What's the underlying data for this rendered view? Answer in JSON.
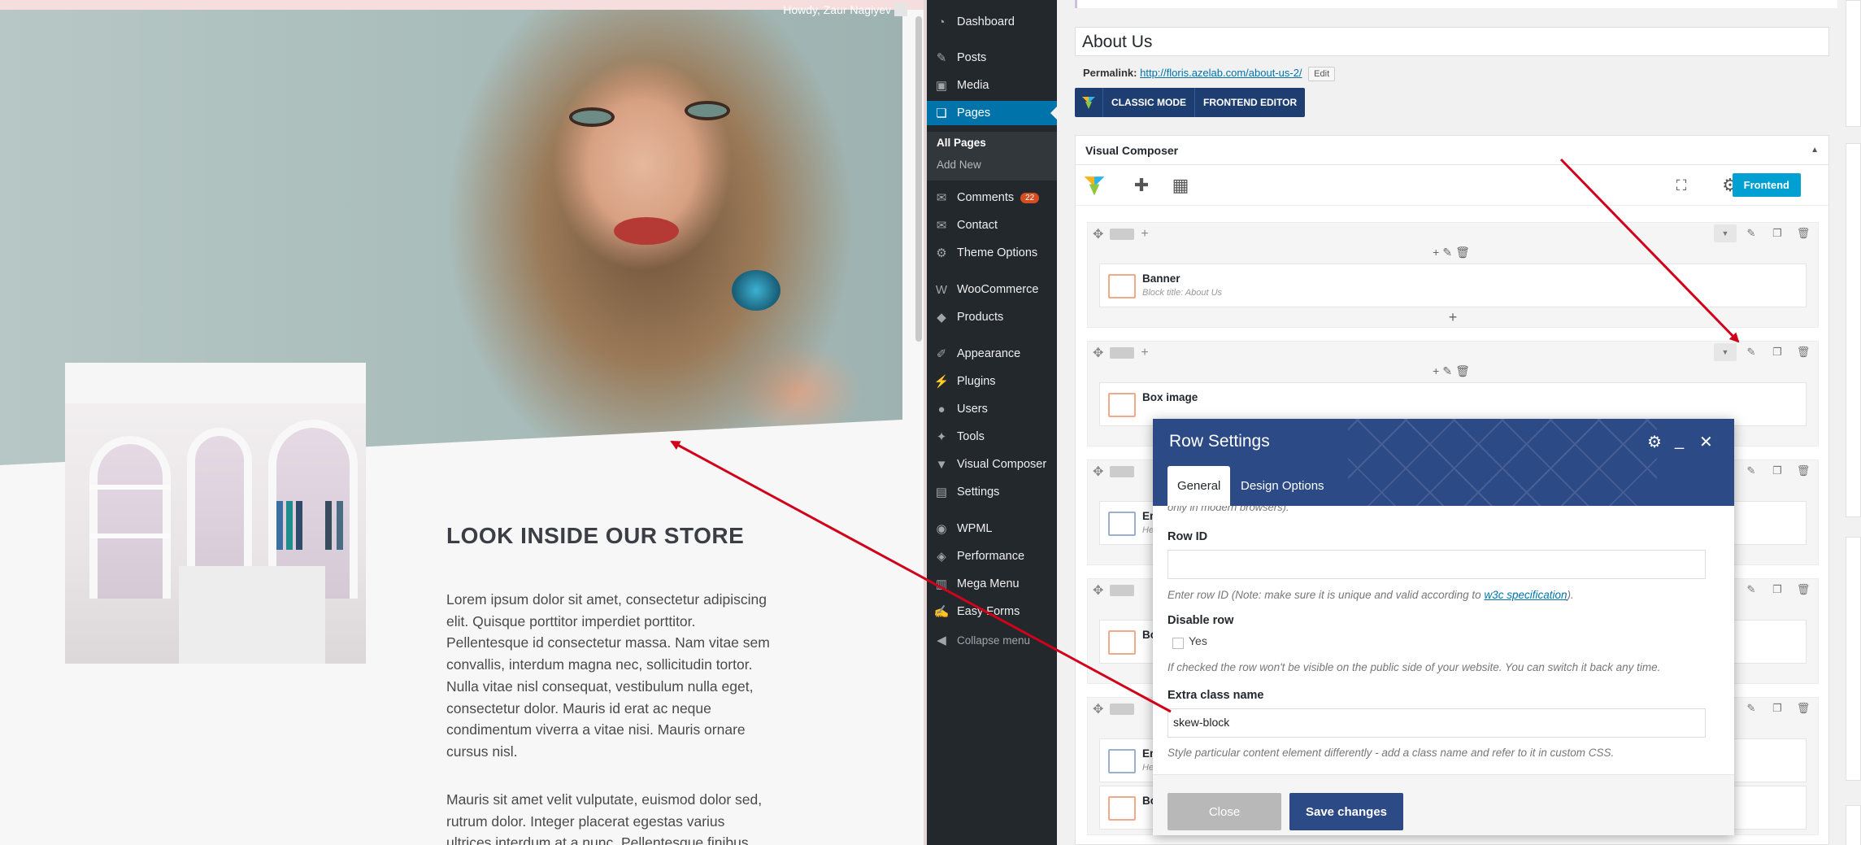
{
  "preview": {
    "howdy": "Howdy, Zaur Nagiyev",
    "section_title": "LOOK INSIDE OUR STORE",
    "paragraph1_lines": [
      "Lorem ipsum dolor sit amet, consectetur adipiscing",
      "elit. Quisque porttitor imperdiet porttitor.",
      "Pellentesque id consectetur massa. Nam vitae sem",
      "convallis, interdum magna nec, sollicitudin tortor.",
      "Nulla vitae nisl consequat, vestibulum nulla eget,",
      "consectetur dolor. Mauris id erat ac neque",
      "condimentum viverra a vitae nisi. Mauris ornare",
      "cursus nisl."
    ],
    "paragraph2_lines": [
      "Mauris sit amet velit vulputate, euismod dolor sed,",
      "rutrum dolor. Integer placerat egestas varius",
      "ultrices interdum at a nunc. Pellentesque finibus"
    ]
  },
  "admin_menu": {
    "items": [
      {
        "label": "Dashboard",
        "icon": "dashboard-icon"
      },
      {
        "label": "Posts",
        "icon": "pin-icon"
      },
      {
        "label": "Media",
        "icon": "media-icon"
      },
      {
        "label": "Pages",
        "icon": "pages-icon",
        "active": true
      },
      {
        "label": "Comments",
        "icon": "comment-icon",
        "badge": "22"
      },
      {
        "label": "Contact",
        "icon": "mail-icon"
      },
      {
        "label": "Theme Options",
        "icon": "gear-icon"
      },
      {
        "label": "WooCommerce",
        "icon": "woo-icon"
      },
      {
        "label": "Products",
        "icon": "box-icon"
      },
      {
        "label": "Appearance",
        "icon": "brush-icon"
      },
      {
        "label": "Plugins",
        "icon": "plug-icon"
      },
      {
        "label": "Users",
        "icon": "user-icon"
      },
      {
        "label": "Tools",
        "icon": "wrench-icon"
      },
      {
        "label": "Visual Composer",
        "icon": "vc-icon"
      },
      {
        "label": "Settings",
        "icon": "settings-icon"
      },
      {
        "label": "WPML",
        "icon": "chat-icon"
      },
      {
        "label": "Performance",
        "icon": "performance-icon"
      },
      {
        "label": "Mega Menu",
        "icon": "megamenu-icon"
      },
      {
        "label": "Easy Forms",
        "icon": "forms-icon"
      }
    ],
    "submenu": [
      "All Pages",
      "Add New"
    ],
    "collapse": "Collapse menu"
  },
  "editor": {
    "title": "About Us",
    "permalink_label": "Permalink:",
    "permalink_url": "http://floris.azelab.com/about-us-2/",
    "edit_label": "Edit",
    "classic_mode": "CLASSIC MODE",
    "frontend_editor": "FRONTEND EDITOR",
    "vc_title": "Visual Composer",
    "frontend_btn": "Frontend",
    "banner_title": "Banner",
    "banner_sub": "Block title: About Us",
    "box_image": "Box image",
    "el_partial_1": "Em",
    "el_partial_1_sub": "He",
    "el_partial_2": "Bo",
    "el_partial_3": "Em",
    "el_partial_3_sub": "He",
    "el_partial_4": "Bo"
  },
  "modal": {
    "title": "Row Settings",
    "tab_general": "General",
    "tab_design": "Design Options",
    "cut_text": "only in modern browsers).",
    "row_id_label": "Row ID",
    "row_id_value": "",
    "row_id_help": "Enter row ID (Note: make sure it is unique and valid according to ",
    "row_id_link": "w3c specification",
    "row_id_help_end": ").",
    "disable_label": "Disable row",
    "disable_yes": "Yes",
    "disable_help": "If checked the row won't be visible on the public side of your website. You can switch it back any time.",
    "extra_label": "Extra class name",
    "extra_value": "skew-block",
    "extra_help": "Style particular content element differently - add a class name and refer to it in custom CSS.",
    "close": "Close",
    "save": "Save changes"
  },
  "colors": {
    "wp_admin_dark": "#23282d",
    "wp_blue": "#0073aa",
    "vc_blue": "#2c4a86",
    "frontend_blue": "#00a0d2",
    "arrow_red": "#d0021b"
  }
}
